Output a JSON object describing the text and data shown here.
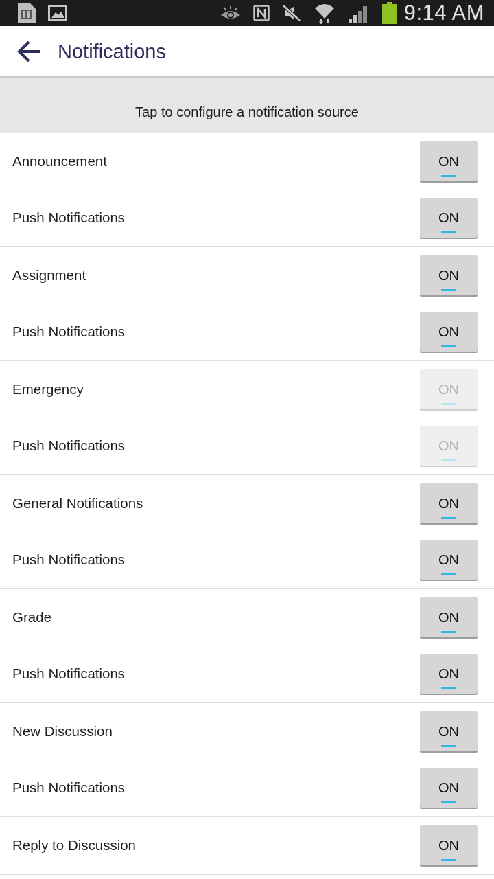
{
  "status_bar": {
    "time": "9:14 AM"
  },
  "action_bar": {
    "title": "Notifications"
  },
  "header": {
    "text": "Tap to configure a notification source"
  },
  "groups": [
    {
      "rows": [
        {
          "label": "Announcement",
          "toggle": {
            "text": "ON",
            "on": true,
            "disabled": false
          }
        },
        {
          "label": "Push Notifications",
          "toggle": {
            "text": "ON",
            "on": true,
            "disabled": false
          }
        }
      ]
    },
    {
      "rows": [
        {
          "label": "Assignment",
          "toggle": {
            "text": "ON",
            "on": true,
            "disabled": false
          }
        },
        {
          "label": "Push Notifications",
          "toggle": {
            "text": "ON",
            "on": true,
            "disabled": false
          }
        }
      ]
    },
    {
      "rows": [
        {
          "label": "Emergency",
          "toggle": {
            "text": "ON",
            "on": true,
            "disabled": true
          }
        },
        {
          "label": "Push Notifications",
          "toggle": {
            "text": "ON",
            "on": true,
            "disabled": true
          }
        }
      ]
    },
    {
      "rows": [
        {
          "label": "General Notifications",
          "toggle": {
            "text": "ON",
            "on": true,
            "disabled": false
          }
        },
        {
          "label": "Push Notifications",
          "toggle": {
            "text": "ON",
            "on": true,
            "disabled": false
          }
        }
      ]
    },
    {
      "rows": [
        {
          "label": "Grade",
          "toggle": {
            "text": "ON",
            "on": true,
            "disabled": false
          }
        },
        {
          "label": "Push Notifications",
          "toggle": {
            "text": "ON",
            "on": true,
            "disabled": false
          }
        }
      ]
    },
    {
      "rows": [
        {
          "label": "New Discussion",
          "toggle": {
            "text": "ON",
            "on": true,
            "disabled": false
          }
        },
        {
          "label": "Push Notifications",
          "toggle": {
            "text": "ON",
            "on": true,
            "disabled": false
          }
        }
      ]
    },
    {
      "rows": [
        {
          "label": "Reply to Discussion",
          "toggle": {
            "text": "ON",
            "on": true,
            "disabled": false
          }
        }
      ]
    }
  ]
}
